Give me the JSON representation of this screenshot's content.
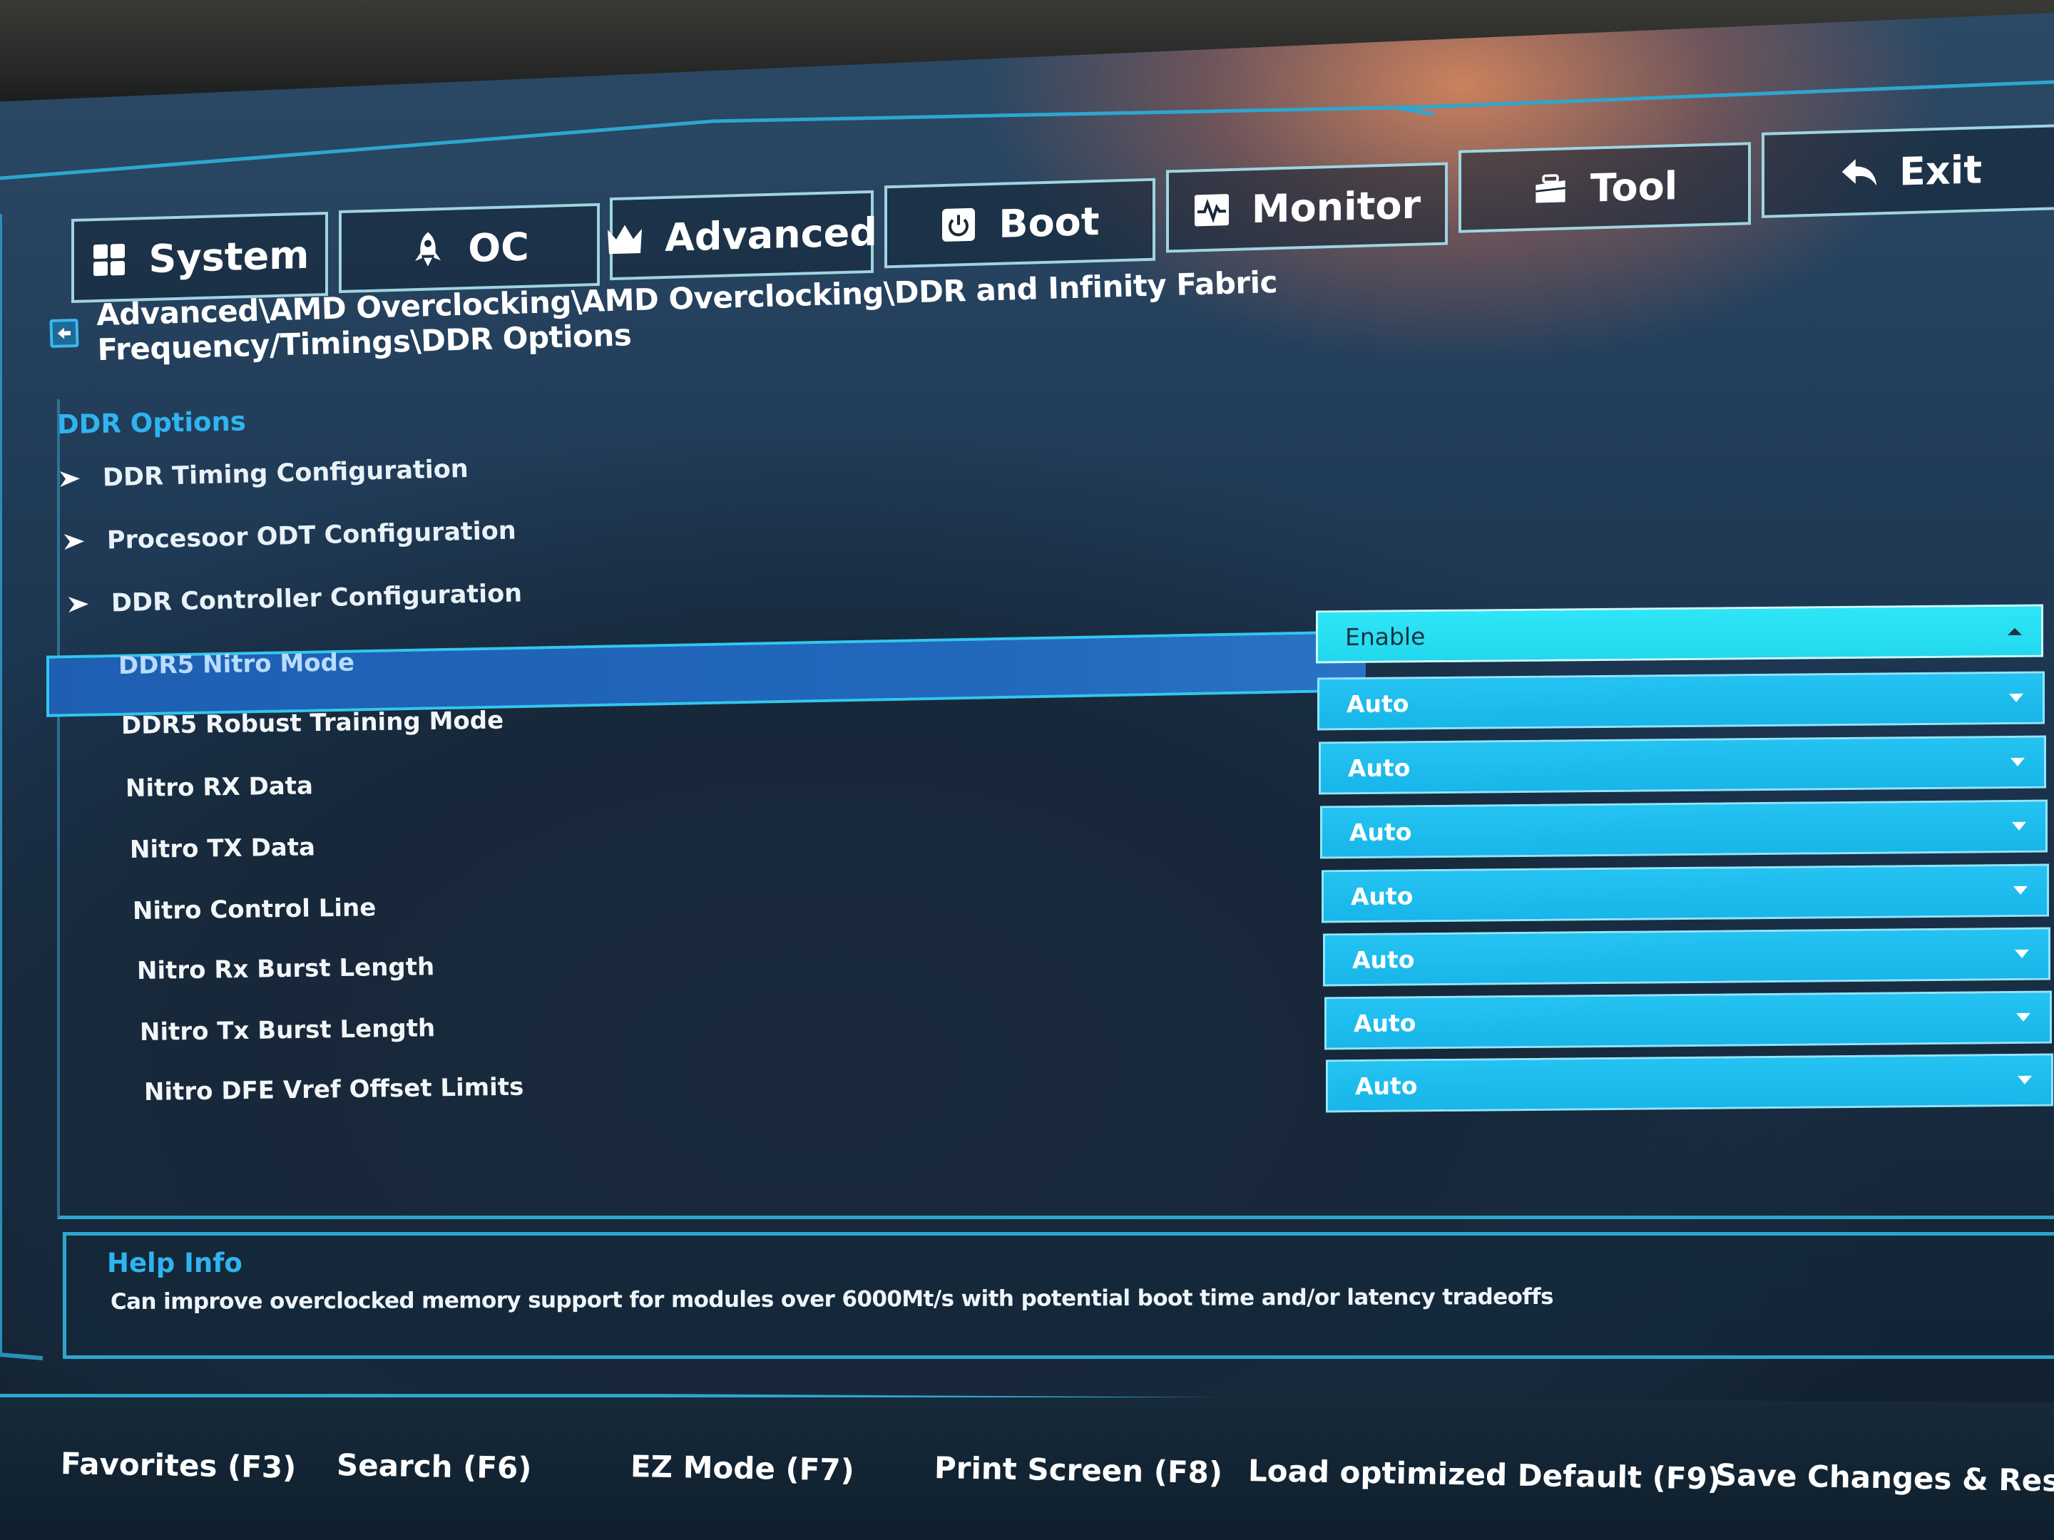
{
  "tabs": {
    "system": "System",
    "oc": "OC",
    "advanced": "Advanced",
    "boot": "Boot",
    "monitor": "Monitor",
    "tool": "Tool",
    "exit": "Exit"
  },
  "breadcrumb": "Advanced\\AMD Overclocking\\AMD Overclocking\\DDR and Infinity Fabric Frequency/Timings\\DDR Options",
  "section_title": "DDR Options",
  "submenus": [
    {
      "label": "DDR Timing Configuration"
    },
    {
      "label": "Procesoor ODT Configuration"
    },
    {
      "label": "DDR Controller Configuration"
    }
  ],
  "options": [
    {
      "label": "DDR5 Nitro Mode",
      "value": "Enable",
      "selected": true
    },
    {
      "label": "DDR5 Robust Training Mode",
      "value": "Auto"
    },
    {
      "label": "Nitro RX Data",
      "value": "Auto"
    },
    {
      "label": "Nitro TX Data",
      "value": "Auto"
    },
    {
      "label": "Nitro Control Line",
      "value": "Auto"
    },
    {
      "label": "Nitro Rx Burst Length",
      "value": "Auto"
    },
    {
      "label": "Nitro Tx Burst Length",
      "value": "Auto"
    },
    {
      "label": "Nitro DFE Vref Offset Limits",
      "value": "Auto"
    }
  ],
  "help": {
    "title": "Help Info",
    "text": "Can improve overclocked memory support for modules over 6000Mt/s with potential boot time and/or latency tradeoffs"
  },
  "footer": {
    "favorites": "Favorites (F3)",
    "search": "Search (F6)",
    "ez_mode": "EZ Mode (F7)",
    "print_screen": "Print Screen (F8)",
    "load_default": "Load optimized Default (F9)",
    "save_reset": "Save Changes & Reset ("
  },
  "colors": {
    "accent": "#2fb4f0",
    "dropdown": "#1fbcef",
    "selected_dropdown": "#2ee6f7",
    "selected_row": "#2168bd"
  }
}
